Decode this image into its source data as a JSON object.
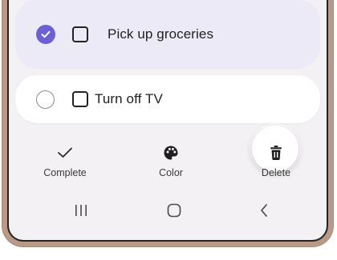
{
  "items": [
    {
      "text": "Pick up groceries",
      "selected": true,
      "done": false
    },
    {
      "text": "Turn off TV",
      "selected": false,
      "done": false
    }
  ],
  "actions": {
    "complete": {
      "label": "Complete",
      "icon": "checkmark-icon"
    },
    "color": {
      "label": "Color",
      "icon": "palette-icon"
    },
    "delete": {
      "label": "Delete",
      "icon": "trash-icon"
    }
  },
  "nav": {
    "recent": {
      "icon": "recent-apps-icon"
    },
    "home": {
      "icon": "home-icon"
    },
    "back": {
      "icon": "back-icon"
    }
  },
  "colors": {
    "accent": "#6c5fd3",
    "selected_card": "#eceaf7",
    "screen_bg": "#f3f1f4",
    "frame": "#b99a86"
  }
}
